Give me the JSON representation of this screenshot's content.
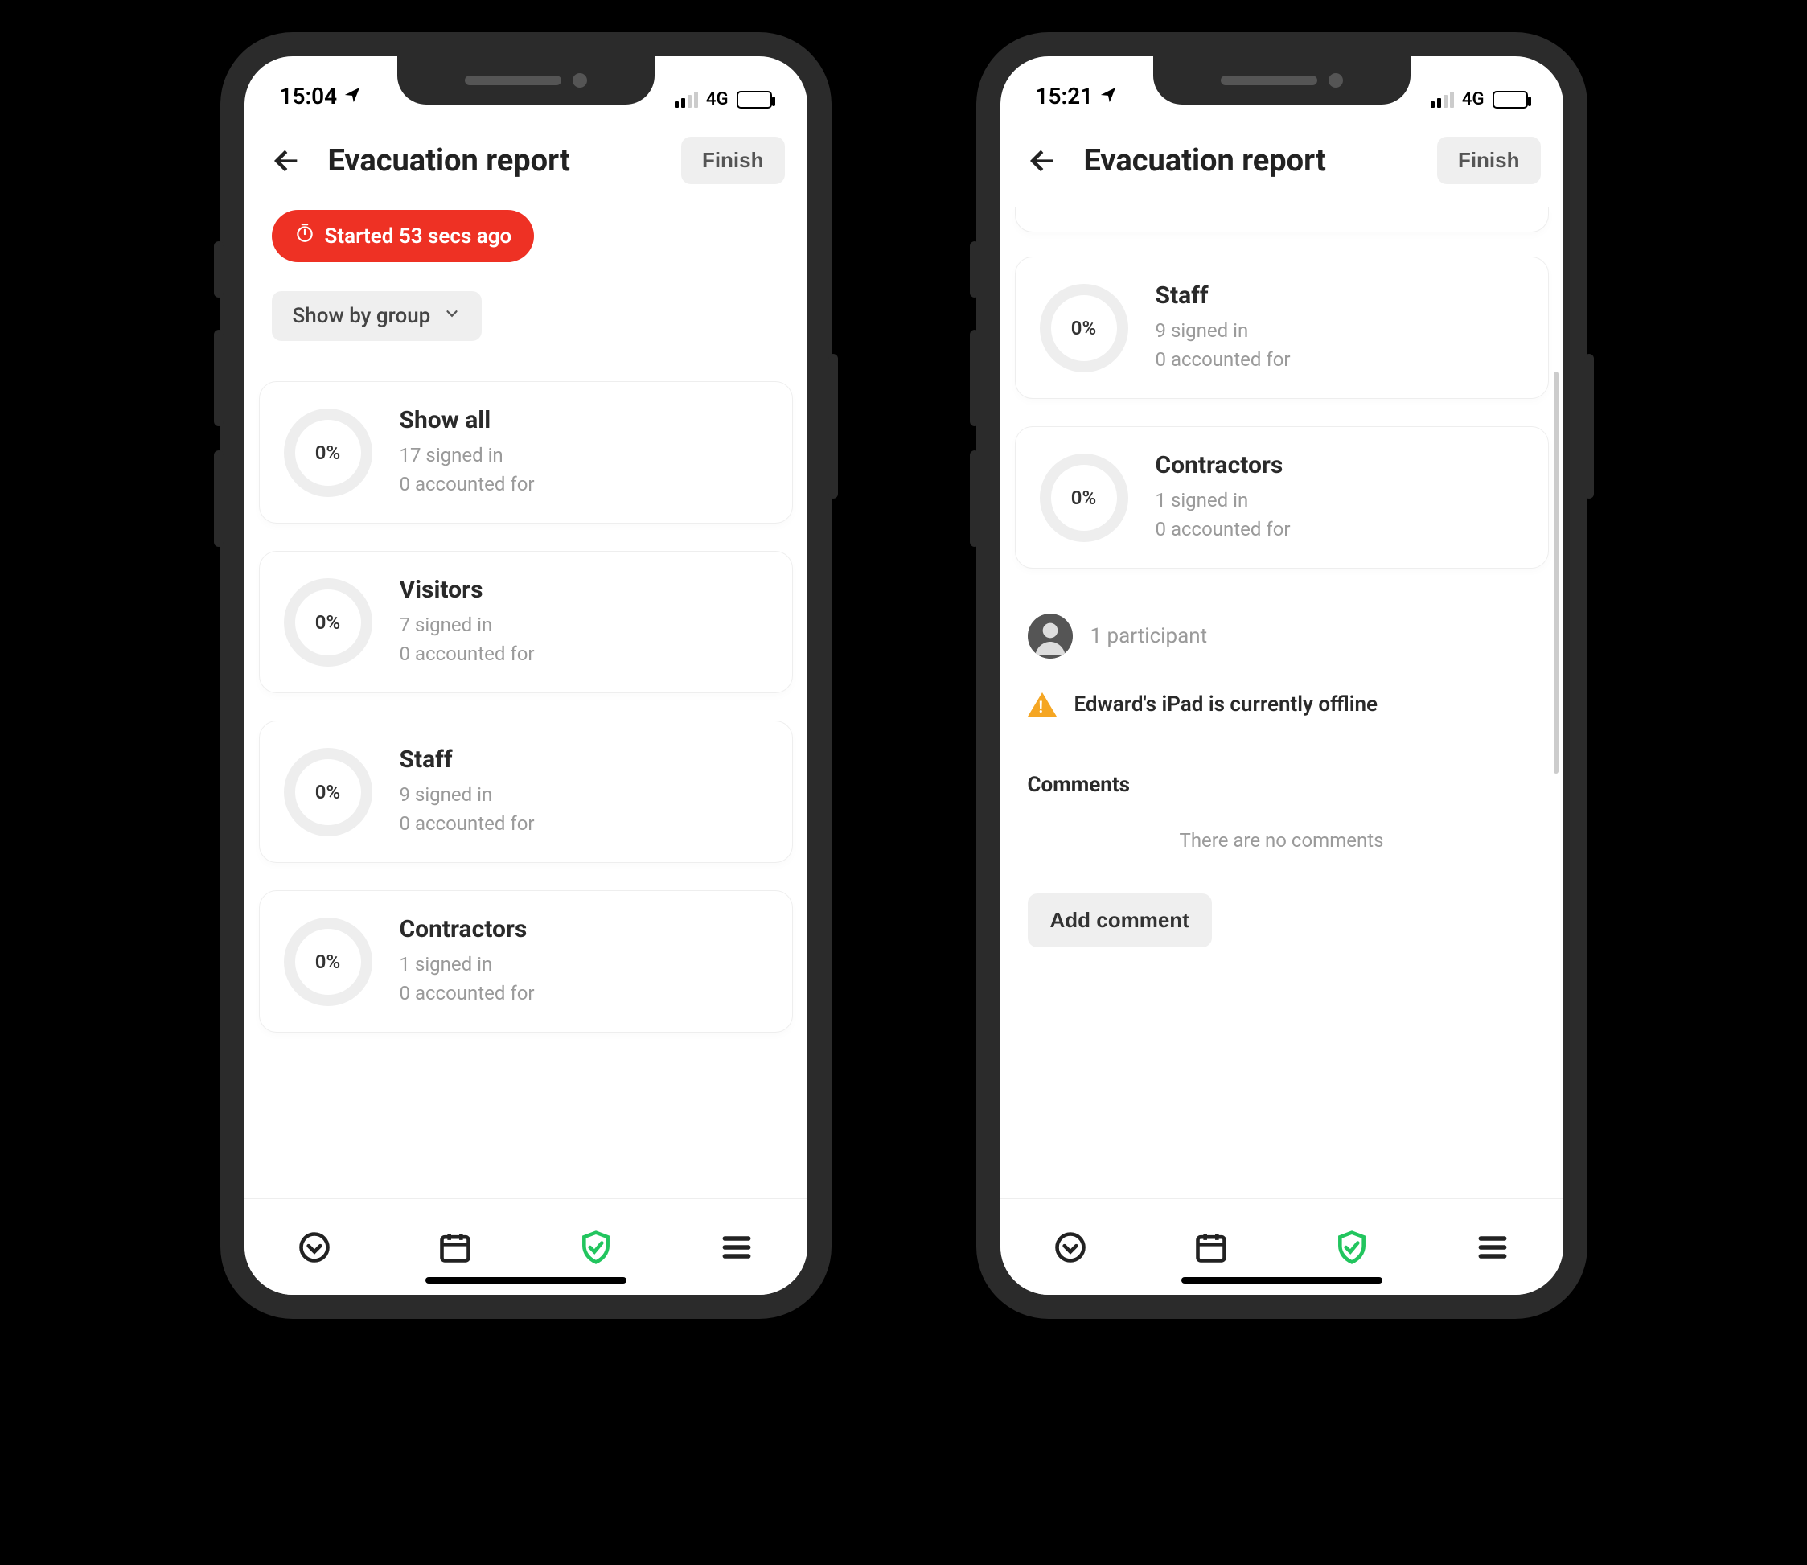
{
  "statusbar": {
    "left": {
      "time": "15:04",
      "net": "4G"
    },
    "right": {
      "time": "15:21",
      "net": "4G"
    }
  },
  "header": {
    "title": "Evacuation report",
    "finish": "Finish"
  },
  "left": {
    "startedPill": "Started 53 secs ago",
    "dropdownLabel": "Show by group",
    "cards": [
      {
        "pct": "0%",
        "title": "Show all",
        "line1": "17 signed in",
        "line2": "0 accounted for"
      },
      {
        "pct": "0%",
        "title": "Visitors",
        "line1": "7 signed in",
        "line2": "0 accounted for"
      },
      {
        "pct": "0%",
        "title": "Staff",
        "line1": "9 signed in",
        "line2": "0 accounted for"
      },
      {
        "pct": "0%",
        "title": "Contractors",
        "line1": "1 signed in",
        "line2": "0 accounted for"
      }
    ]
  },
  "right": {
    "cards": [
      {
        "pct": "0%",
        "title": "Staff",
        "line1": "9 signed in",
        "line2": "0 accounted for"
      },
      {
        "pct": "0%",
        "title": "Contractors",
        "line1": "1 signed in",
        "line2": "0 accounted for"
      }
    ],
    "participantsText": "1 participant",
    "warningText": "Edward's iPad is currently offline",
    "commentsHeader": "Comments",
    "emptyComments": "There are no comments",
    "addComment": "Add comment"
  }
}
